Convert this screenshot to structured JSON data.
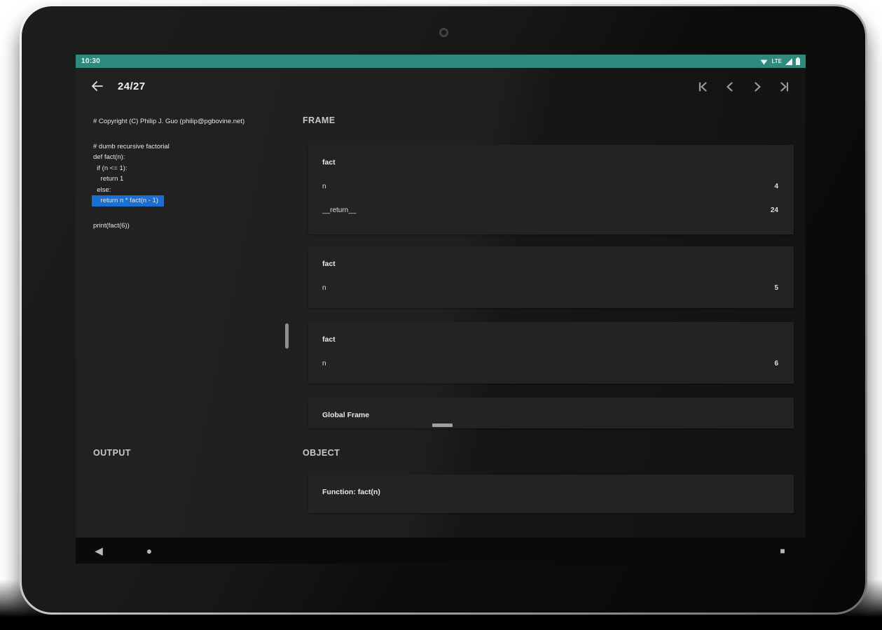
{
  "status_bar": {
    "time": "10:30",
    "network_label": "LTE",
    "bg_color": "#2e8a7c",
    "icons": [
      "wifi-icon",
      "lte-label",
      "signal-icon",
      "battery-icon"
    ]
  },
  "toolbar": {
    "title": "24/27",
    "back_icon": "arrow-left",
    "nav_icons": [
      "first-step",
      "previous-step",
      "next-step",
      "last-step"
    ]
  },
  "code_panel": {
    "highlight_color": "#1a6fd4",
    "lines": [
      {
        "text": "# Copyright (C) Philip J. Guo (philip@pgbovine.net)"
      },
      {
        "text": "# dumb recursive factorial"
      },
      {
        "text": "def fact(n):"
      },
      {
        "text": "  if (n <= 1):"
      },
      {
        "text": "    return 1"
      },
      {
        "text": "  else:"
      },
      {
        "text": "    return n * fact(n - 1)",
        "highlighted": true
      },
      {
        "text": "print(fact(6))"
      }
    ]
  },
  "frame_panel": {
    "header": "FRAME",
    "frames": [
      {
        "title": "fact",
        "vars": [
          {
            "name": "n",
            "value": "4"
          },
          {
            "name": "__return__",
            "value": "24"
          }
        ]
      },
      {
        "title": "fact",
        "vars": [
          {
            "name": "n",
            "value": "5"
          }
        ]
      },
      {
        "title": "fact",
        "vars": [
          {
            "name": "n",
            "value": "6"
          }
        ]
      },
      {
        "title": "Global Frame",
        "vars": []
      }
    ]
  },
  "output_panel": {
    "header": "OUTPUT"
  },
  "object_panel": {
    "header": "OBJECT",
    "objects": [
      {
        "label": "Function: fact(n)"
      }
    ]
  },
  "nav_bar": {
    "icons": [
      "back-triangle",
      "home-circle",
      "recents-square"
    ],
    "back_glyph": "◀",
    "home_glyph": "●",
    "recents_glyph": "■"
  }
}
